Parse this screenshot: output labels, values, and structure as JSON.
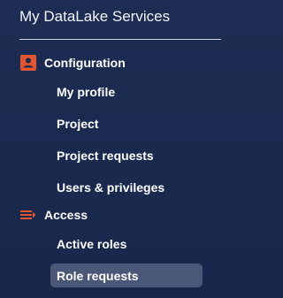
{
  "app": {
    "title": "My DataLake Services"
  },
  "colors": {
    "accent": "#e1562e",
    "background": "#1c2b50",
    "active_item_bg": "#4b5777"
  },
  "sections": [
    {
      "label": "Configuration",
      "icon": "account-box-icon",
      "items": [
        {
          "label": "My profile"
        },
        {
          "label": "Project"
        },
        {
          "label": "Project requests"
        },
        {
          "label": "Users & privileges"
        }
      ]
    },
    {
      "label": "Access",
      "icon": "list-lines-icon",
      "items": [
        {
          "label": "Active roles"
        },
        {
          "label": "Role requests",
          "active": true
        }
      ]
    }
  ]
}
